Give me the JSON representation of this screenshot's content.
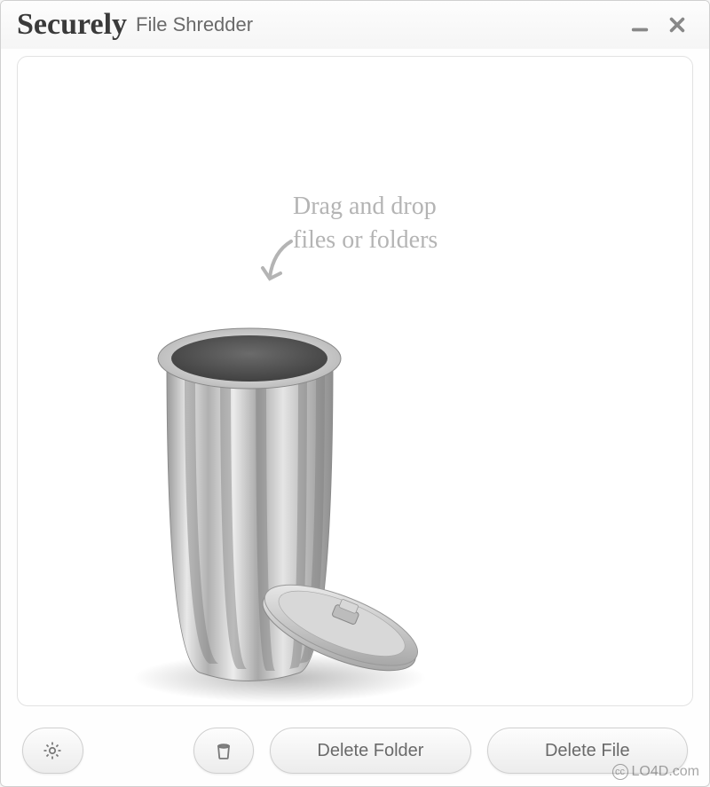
{
  "app": {
    "title_main": "Securely",
    "title_sub": "File Shredder"
  },
  "dropzone": {
    "hint_text": "Drag and drop\nfiles or folders",
    "icon_name": "trash-can-open"
  },
  "toolbar": {
    "settings_icon": "gear-icon",
    "trash_icon": "trash-icon",
    "delete_folder_label": "Delete Folder",
    "delete_file_label": "Delete File"
  },
  "watermark": {
    "text": "LO4D.com",
    "cc": "cc"
  }
}
